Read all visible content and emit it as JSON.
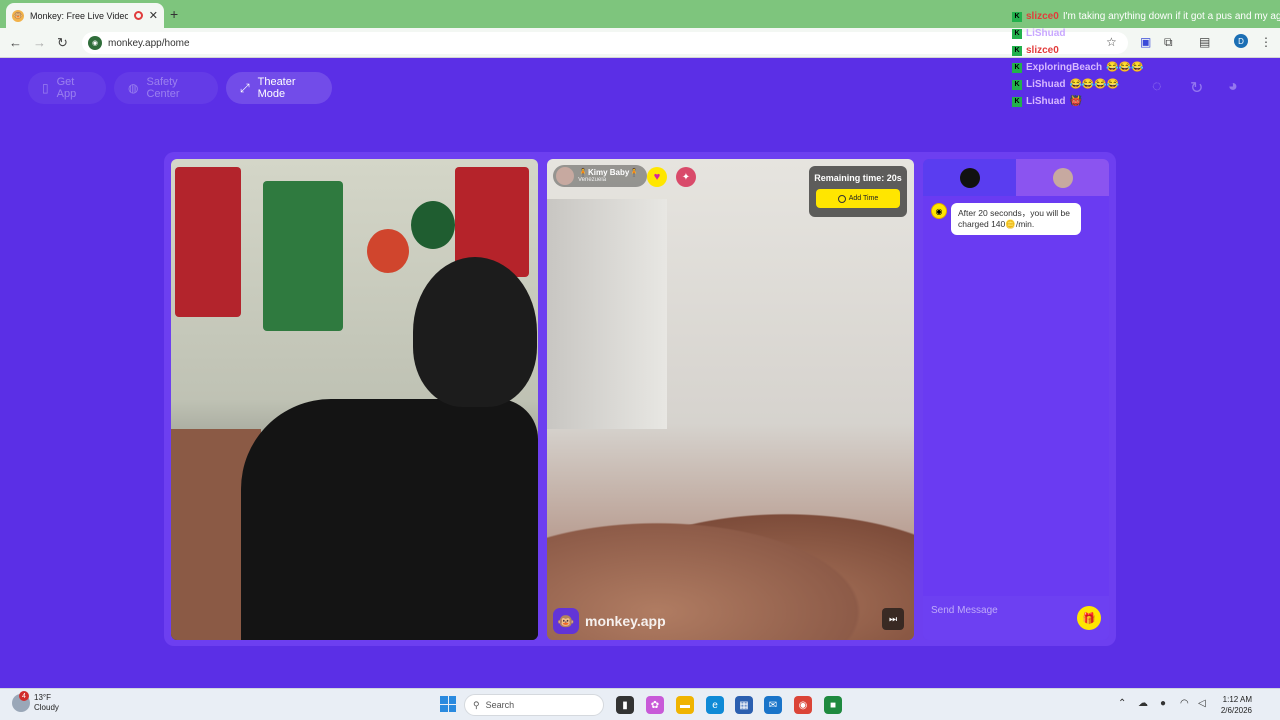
{
  "browser": {
    "tab_title": "Monkey: Free Live Video Ch",
    "new_tab": "+",
    "url": "monkey.app/home",
    "profile_initial": "D"
  },
  "header": {
    "get_app": "Get App",
    "safety_center": "Safety Center",
    "theater_mode": "Theater Mode"
  },
  "stream_chat": [
    {
      "user": "slizce0",
      "color": "#e23b3b",
      "text": "I'm taking anything down if it got a pus and my age"
    },
    {
      "user": "LiShuad",
      "color": "#c9a8ff",
      "text": ""
    },
    {
      "user": "slizce0",
      "color": "#e23b3b",
      "text": ""
    },
    {
      "user": "ExploringBeach",
      "color": "#d7b8ff",
      "text": "😂😂😂"
    },
    {
      "user": "LiShuad",
      "color": "#d7b8ff",
      "text": "😂😂😂😂"
    },
    {
      "user": "LiShuad",
      "color": "#d7b8ff",
      "text": "👹"
    }
  ],
  "peer": {
    "name": "🧍Kimy Baby🧍",
    "country": "Venezuela"
  },
  "timer": {
    "remaining": "Remaining time: 20s",
    "add_time": "Add Time"
  },
  "brand": {
    "name": "monkey.app"
  },
  "chat": {
    "system_message": "After 20 seconds，you will be charged 140🪙/min.",
    "placeholder": "Send Message"
  },
  "taskbar": {
    "weather_badge": "4",
    "temperature": "13°F",
    "condition": "Cloudy",
    "search": "Search",
    "time": "1:12 AM",
    "date": "2/6/2026"
  }
}
